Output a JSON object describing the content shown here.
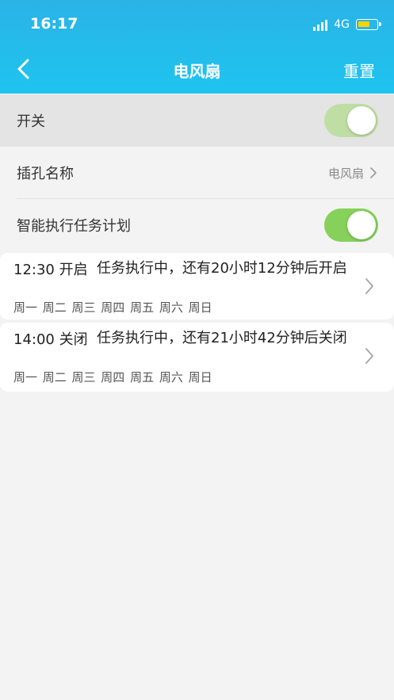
{
  "status_bar": {
    "time": "16:17",
    "network": "4G",
    "battery_color": "#ffd200"
  },
  "nav": {
    "title": "电风扇",
    "reset_label": "重置",
    "back_icon": "chevron-left-icon"
  },
  "settings": {
    "power": {
      "label": "开关",
      "enabled": true
    },
    "socket_name": {
      "label": "插孔名称",
      "value": "电风扇"
    },
    "smart_schedule": {
      "label": "智能执行任务计划",
      "enabled": true
    }
  },
  "schedules": [
    {
      "time_action": "12:30 开启",
      "description": "任务执行中，还有20小时12分钟后开启",
      "days": "周一 周二 周三 周四 周五 周六 周日"
    },
    {
      "time_action": "14:00 关闭",
      "description": "任务执行中，还有21小时42分钟后关闭",
      "days": "周一 周二 周三 周四 周五 周六 周日"
    }
  ],
  "colors": {
    "header": "#1ec4ef",
    "toggle_on": "#86d159",
    "toggle_power": "#bfdea3"
  }
}
